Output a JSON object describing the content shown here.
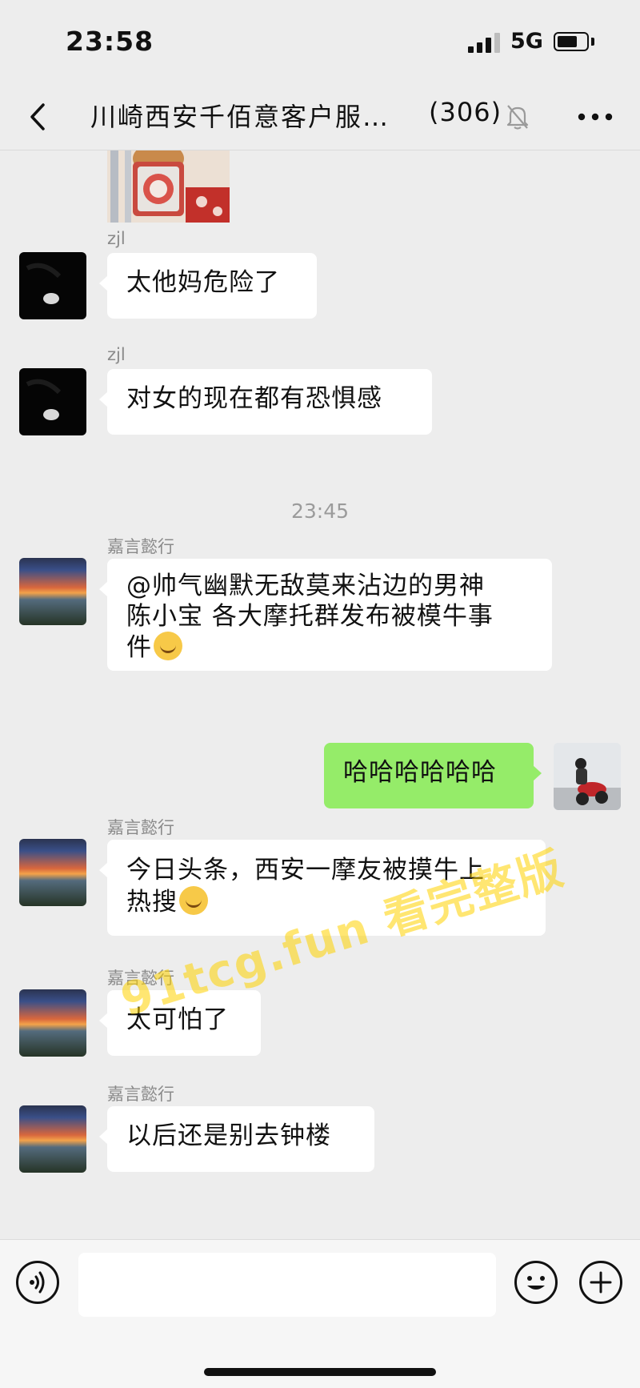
{
  "status_bar": {
    "time": "23:58",
    "network": "5G"
  },
  "header": {
    "title": "川崎西安千佰意客户服…",
    "member_count": "(306)",
    "muted": true
  },
  "messages": [
    {
      "type": "image",
      "from": "others",
      "partial": true
    },
    {
      "type": "text",
      "from": "others",
      "sender": "zjl",
      "avatar": "dark",
      "text": "太他妈危险了"
    },
    {
      "type": "text",
      "from": "others",
      "sender": "zjl",
      "avatar": "dark",
      "text": "对女的现在都有恐惧感"
    },
    {
      "type": "time",
      "text": "23:45"
    },
    {
      "type": "text",
      "from": "others",
      "sender": "嘉言懿行",
      "avatar": "sunset",
      "lines": [
        "@帅气幽默无敌莫来沾边的男神",
        "陈小宝 各大摩托群发布被模牛事",
        "件"
      ],
      "emoji": "tears-of-joy-emoji"
    },
    {
      "type": "text",
      "from": "me",
      "avatar": "rider",
      "text": "哈哈哈哈哈哈"
    },
    {
      "type": "text",
      "from": "others",
      "sender": "嘉言懿行",
      "avatar": "sunset",
      "lines": [
        "今日头条，西安一摩友被摸牛上",
        "热搜"
      ],
      "emoji": "grinning-emoji"
    },
    {
      "type": "text",
      "from": "others",
      "sender": "嘉言懿行",
      "avatar": "sunset",
      "text": "太可怕了"
    },
    {
      "type": "text",
      "from": "others",
      "sender": "嘉言懿行",
      "avatar": "sunset",
      "text": "以后还是别去钟楼"
    }
  ],
  "watermark": "91tcg.fun 看完整版",
  "input_bar": {
    "placeholder": ""
  },
  "colors": {
    "background": "#ededed",
    "my_bubble": "#95ec69",
    "their_bubble": "#ffffff",
    "watermark": "#ffd200"
  }
}
